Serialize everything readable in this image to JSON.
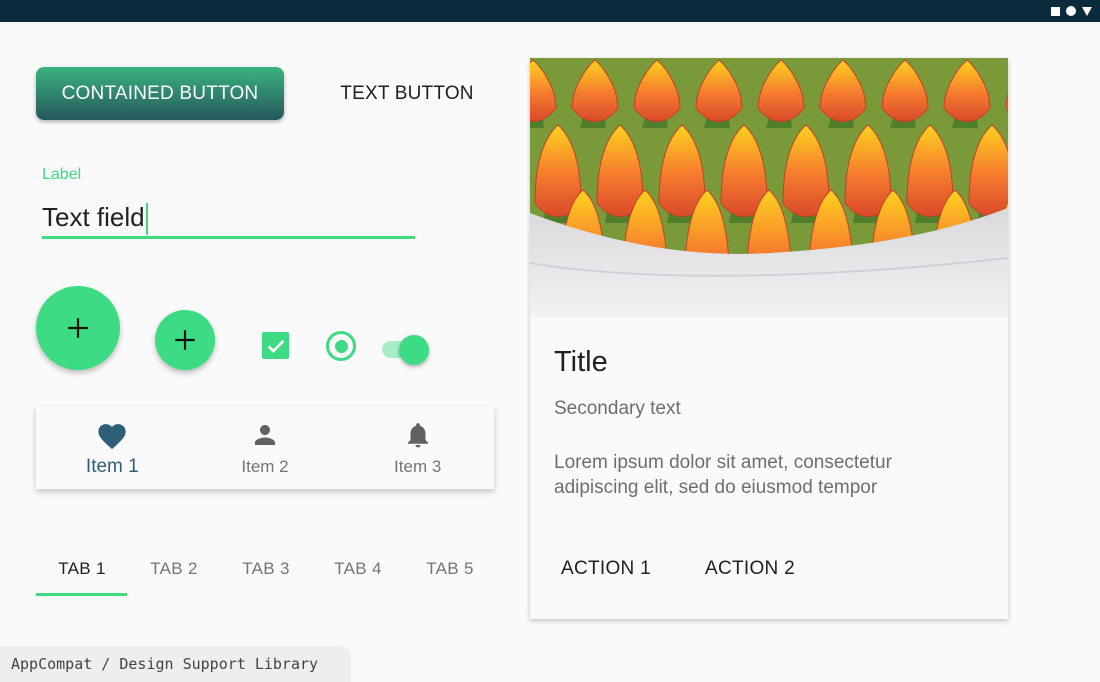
{
  "buttons": {
    "contained": "CONTAINED BUTTON",
    "text": "TEXT BUTTON"
  },
  "text_field": {
    "label": "Label",
    "value": "Text field"
  },
  "icons": {
    "fab_large": "add-icon",
    "fab_small": "add-icon",
    "checkbox": "check-icon",
    "nav_item_1": "heart-icon",
    "nav_item_2": "person-icon",
    "nav_item_3": "bell-icon",
    "status": [
      "square-icon",
      "circle-icon",
      "triangle-icon"
    ]
  },
  "controls": {
    "checkbox_checked": true,
    "radio_selected": true,
    "switch_on": true
  },
  "bottom_nav": {
    "items": [
      {
        "label": "Item 1",
        "active": true
      },
      {
        "label": "Item 2",
        "active": false
      },
      {
        "label": "Item 3",
        "active": false
      }
    ]
  },
  "tabs": [
    {
      "label": "TAB 1",
      "active": true
    },
    {
      "label": "TAB 2",
      "active": false
    },
    {
      "label": "TAB 3",
      "active": false
    },
    {
      "label": "TAB 4",
      "active": false
    },
    {
      "label": "TAB 5",
      "active": false
    }
  ],
  "footer": {
    "label": "AppCompat / Design Support Library"
  },
  "card": {
    "image": "tulips-photo",
    "title": "Title",
    "secondary": "Secondary text",
    "body": "Lorem ipsum dolor sit amet, consectetur adipiscing elit, sed do eiusmod tempor",
    "actions": [
      "ACTION 1",
      "ACTION 2"
    ]
  },
  "colors": {
    "accent": "#3ddc84",
    "primary_dark": "#26575e",
    "status_bar": "#0c2c3d",
    "nav_active": "#2f5f78",
    "text_primary": "#212121",
    "text_secondary": "#757575"
  }
}
